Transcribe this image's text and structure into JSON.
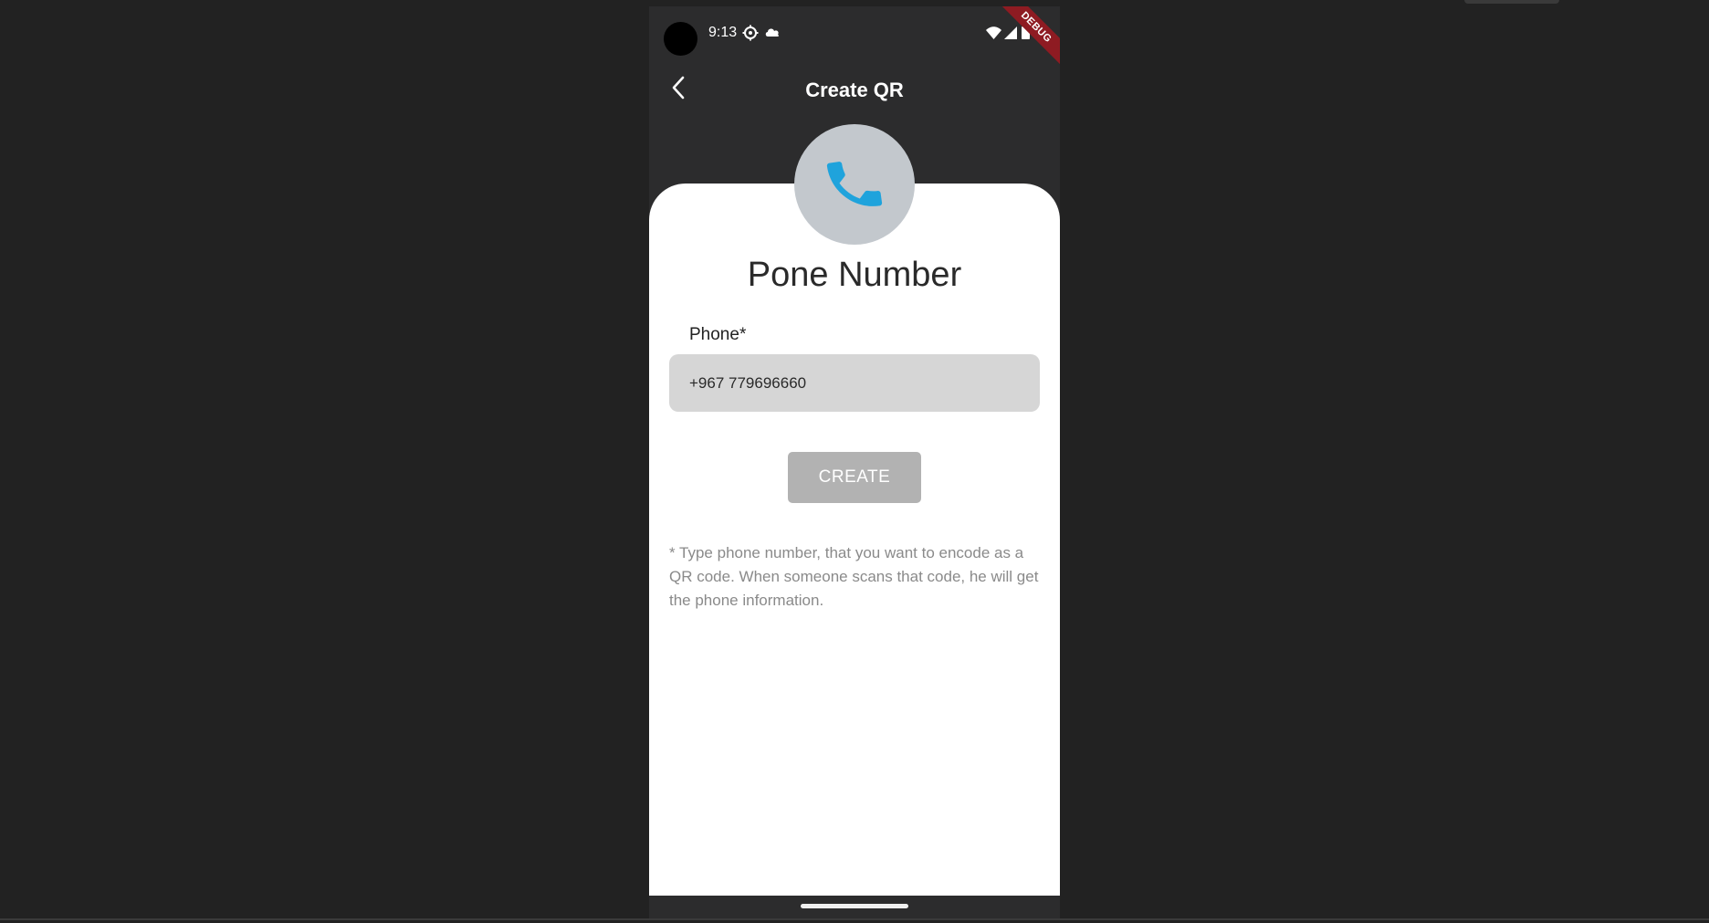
{
  "status_bar": {
    "time": "9:13",
    "icons": [
      "settings-gear-icon",
      "cloud-icon",
      "wifi-icon",
      "signal-icon",
      "battery-icon"
    ],
    "debug_banner": "DEBUG"
  },
  "app_bar": {
    "title": "Create QR",
    "back_icon": "chevron-left-icon"
  },
  "card": {
    "icon": "phone-icon",
    "icon_color": "#1fa3dc",
    "title": "Pone Number",
    "field_label": "Phone*",
    "phone_value": "+967 779696660",
    "create_label": "CREATE",
    "help_text": "* Type phone number, that you want to encode as a QR code. When someone scans that code, he will get the phone information."
  },
  "colors": {
    "background": "#222222",
    "app_surface": "#2c2c2d",
    "card": "#ffffff",
    "field": "#d6d6d6",
    "button_disabled": "#b2b2b2",
    "debug_ribbon": "#8e1b22"
  }
}
